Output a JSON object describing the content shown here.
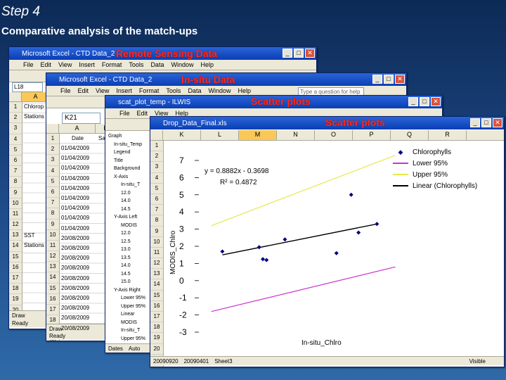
{
  "slide": {
    "title": "Step 4",
    "subtitle": "Comparative analysis of the match-ups"
  },
  "windows": {
    "excel1": {
      "title": "Microsoft Excel - CTD Data_2",
      "overlay_label": "Remote Sensing Data",
      "menu": [
        "File",
        "Edit",
        "View",
        "Insert",
        "Format",
        "Tools",
        "Data",
        "Window",
        "Help"
      ],
      "help_placeholder": "Type a question for help",
      "name_box": "L18",
      "column_active": "A",
      "row_numbers": [
        "1",
        "2",
        "3",
        "4",
        "5",
        "6",
        "7",
        "8",
        "9",
        "10",
        "11",
        "12",
        "13",
        "14",
        "15",
        "16",
        "17",
        "18",
        "19",
        "20",
        "21"
      ],
      "cells": {
        "r1": "Chlorop",
        "r2": "Stations",
        "r14": "SST",
        "r15": "Stations"
      },
      "tab": "Draw",
      "status": "Ready"
    },
    "excel2": {
      "title": "Microsoft Excel - CTD Data_2",
      "overlay_label": "In-situ Data",
      "menu": [
        "File",
        "Edit",
        "View",
        "Insert",
        "Format",
        "Tools",
        "Data",
        "Window",
        "Help"
      ],
      "help_placeholder": "Type a question for help",
      "name_box": "K21",
      "row_numbers": [
        "1",
        "2",
        "3",
        "4",
        "5",
        "6",
        "7",
        "8",
        "9",
        "10",
        "11",
        "12",
        "13",
        "14",
        "15",
        "16",
        "17",
        "18",
        "19",
        "20"
      ],
      "col_headers": [
        "A",
        "B"
      ],
      "header_row": [
        "Date",
        "Sa"
      ],
      "dates": [
        "01/04/2009",
        "01/04/2009",
        "01/04/2009",
        "01/04/2009",
        "01/04/2009",
        "01/04/2009",
        "01/04/2009",
        "01/04/2009",
        "01/04/2009",
        "20/08/2009",
        "20/08/2009",
        "20/08/2009",
        "20/08/2009",
        "20/08/2009",
        "20/08/2009",
        "20/08/2009",
        "20/08/2009",
        "20/08/2009",
        "20/08/2009"
      ],
      "tab": "Draw",
      "status": "Ready"
    },
    "ilwis": {
      "title": "scat_plot_temp - ILWIS",
      "overlay_label": "Scatter plots",
      "menu": [
        "File",
        "Edit",
        "View",
        "Help"
      ],
      "tree": [
        "Graph",
        "In-situ_Temp",
        "Legend",
        "Title",
        "Background",
        "X-Axis",
        "In-situ_T",
        "12.0",
        "14.0",
        "14.5",
        "Y-Axis Left",
        "MODIS",
        "12.0",
        "12.5",
        "13.0",
        "13.5",
        "14.0",
        "14.5",
        "15.0",
        "Y-Axis Right",
        "Lower 95%",
        "Upper 95%",
        "Linear",
        "MODIS",
        "In-situ_T",
        "Upper 95%",
        "Lower 95%",
        "Linear"
      ],
      "tab": "Dates",
      "tab2": "Auto"
    },
    "excel3": {
      "title": "Drop_Data_Final.xls",
      "overlay_label": "Scatter plots",
      "col_headers": [
        "K",
        "L",
        "M",
        "N",
        "O",
        "P",
        "Q",
        "R"
      ],
      "active_col": "M",
      "row_numbers": [
        "1",
        "2",
        "3",
        "4",
        "5",
        "6",
        "7",
        "8",
        "9",
        "10",
        "11",
        "12",
        "13",
        "14",
        "15",
        "16",
        "17",
        "18",
        "19",
        "20",
        "21",
        "22",
        "23"
      ],
      "sheet_tabs": [
        "20090920",
        "20090401",
        "Sheet3"
      ],
      "status": "Visible"
    }
  },
  "chart_data": {
    "type": "scatter",
    "xlabel": "In-situ_Chlro",
    "ylabel": "MODIS_Chlro",
    "ylim": [
      -3,
      7
    ],
    "yticks": [
      "7",
      "6",
      "5",
      "4",
      "3",
      "2",
      "1",
      "0",
      "-1",
      "-2",
      "-3"
    ],
    "equation": "y = 0.8882x - 0.3698",
    "r2": "R² = 0.4872",
    "legend_position": "top-right",
    "colors": {
      "points": "#000080",
      "lower": "#cc33cc",
      "upper": "#e8e84a",
      "linear": "#000000"
    },
    "series": [
      {
        "name": "Chlorophylls",
        "type": "scatter",
        "x": [
          2.1,
          3.1,
          3.2,
          3.3,
          3.8,
          5.2,
          5.6,
          5.8,
          6.3
        ],
        "y": [
          1.7,
          1.95,
          1.25,
          1.2,
          2.4,
          1.6,
          5.0,
          2.8,
          3.3
        ]
      },
      {
        "name": "Lower 95%",
        "type": "line",
        "x": [
          1.8,
          6.8
        ],
        "y": [
          -1.8,
          0.8
        ]
      },
      {
        "name": "Upper 95%",
        "type": "line",
        "x": [
          1.8,
          6.8
        ],
        "y": [
          3.2,
          7.3
        ]
      },
      {
        "name": "Linear (Chlorophylls)",
        "type": "line",
        "x": [
          2.1,
          6.3
        ],
        "y": [
          1.5,
          3.3
        ]
      }
    ]
  }
}
